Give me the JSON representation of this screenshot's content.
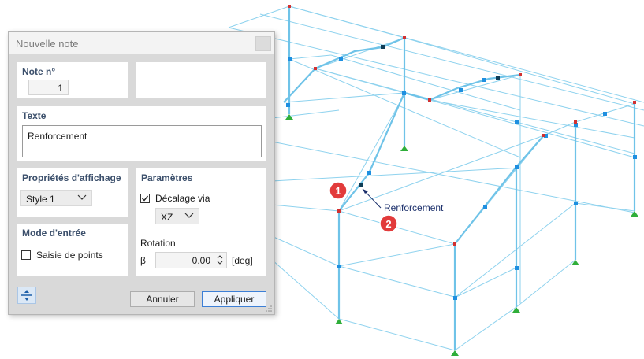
{
  "dialog": {
    "title": "Nouvelle note",
    "note_panel": {
      "label": "Note n°",
      "value": "1"
    },
    "text_panel": {
      "label": "Texte",
      "value": "Renforcement"
    },
    "display_panel": {
      "label": "Propriétés d'affichage",
      "style_value": "Style 1"
    },
    "input_panel": {
      "label": "Mode d'entrée",
      "checkbox_label": "Saisie de points",
      "checked": false
    },
    "params_panel": {
      "label": "Paramètres",
      "offset_label": "Décalage via",
      "offset_checked": true,
      "plane_value": "XZ",
      "rotation_label": "Rotation",
      "beta_symbol": "β",
      "beta_value": "0.00",
      "unit": "[deg]"
    },
    "buttons": {
      "cancel": "Annuler",
      "apply": "Appliquer"
    }
  },
  "viewport": {
    "note_label": "Renforcement",
    "badges": [
      "1",
      "2"
    ],
    "colors": {
      "member": "#7ecbea",
      "node": "#1e8fe0",
      "support": "#2fae3a",
      "badge": "#e23b3b"
    }
  }
}
